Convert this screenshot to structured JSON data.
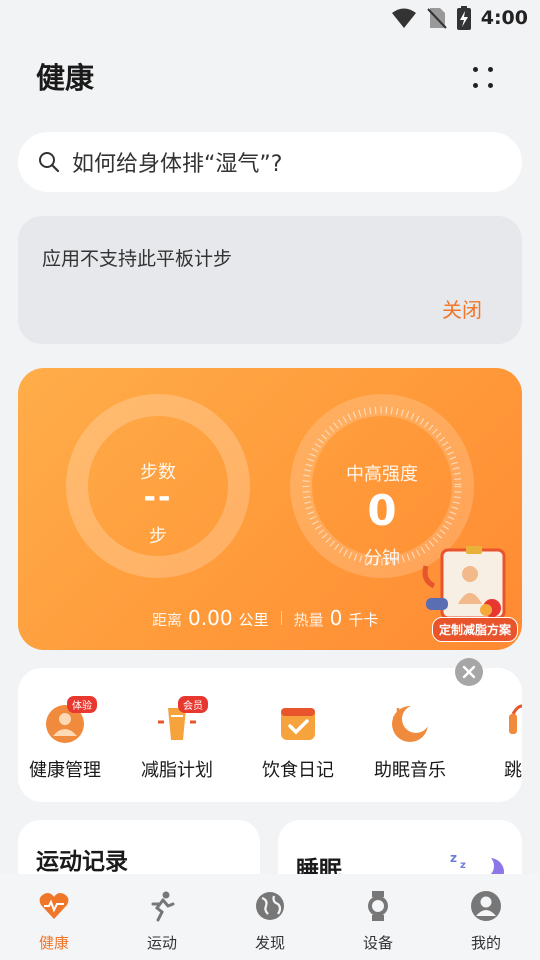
{
  "status_bar": {
    "time": "4:00"
  },
  "header": {
    "title": "健康"
  },
  "search": {
    "text": "如何给身体排“湿气”?"
  },
  "notice": {
    "message": "应用不支持此平板计步",
    "close_label": "关闭"
  },
  "activity": {
    "steps": {
      "label": "步数",
      "value": "--",
      "unit": "步"
    },
    "intensity": {
      "label": "中高强度",
      "value": "0",
      "unit": "分钟"
    },
    "distance": {
      "label": "距离",
      "value": "0.00",
      "unit": "公里"
    },
    "calories": {
      "label": "热量",
      "value": "0",
      "unit": "千卡"
    },
    "plan_badge": "定制减脂方案"
  },
  "shortcuts": [
    {
      "label": "健康管理",
      "tag": "体验",
      "icon": "health-management-icon"
    },
    {
      "label": "减脂计划",
      "tag": "会员",
      "icon": "fat-loss-icon"
    },
    {
      "label": "饮食日记",
      "icon": "diet-diary-icon"
    },
    {
      "label": "助眠音乐",
      "icon": "sleep-music-icon"
    },
    {
      "label": "跳绳",
      "icon": "jump-rope-icon"
    }
  ],
  "cards": {
    "exercise_record": "运动记录",
    "sleep": "睡眠"
  },
  "bottom_nav": [
    {
      "label": "健康",
      "icon": "heart-icon",
      "active": true
    },
    {
      "label": "运动",
      "icon": "running-icon"
    },
    {
      "label": "发现",
      "icon": "globe-icon"
    },
    {
      "label": "设备",
      "icon": "watch-icon"
    },
    {
      "label": "我的",
      "icon": "user-icon"
    }
  ],
  "colors": {
    "accent": "#f0772a",
    "card_orange": "#ff9a3a",
    "background": "#f1f3f5"
  }
}
